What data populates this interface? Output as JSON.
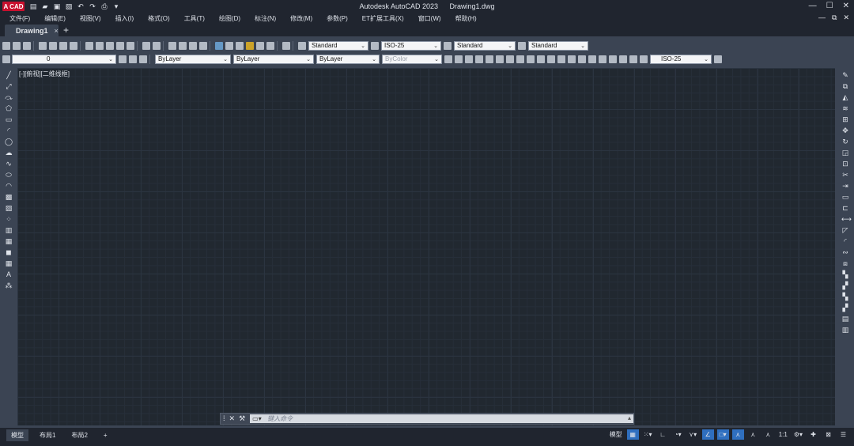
{
  "app": {
    "logo": "A CAD",
    "title": "Autodesk AutoCAD 2023",
    "file": "Drawing1.dwg"
  },
  "window_controls": [
    "—",
    "☐",
    "✕"
  ],
  "doc_controls": [
    "—",
    "⧉",
    "✕"
  ],
  "menu": [
    "文件(F)",
    "编辑(E)",
    "视图(V)",
    "插入(I)",
    "格式(O)",
    "工具(T)",
    "绘图(D)",
    "标注(N)",
    "修改(M)",
    "参数(P)",
    "ET扩展工具(X)",
    "窗口(W)",
    "帮助(H)"
  ],
  "tabs": {
    "active": "Drawing1",
    "close": "×",
    "add": "+"
  },
  "toolbar1": {
    "text_style": "Standard",
    "dim_style": "ISO-25",
    "table_style": "Standard",
    "mleader_style": "Standard"
  },
  "toolbar2": {
    "layer": "0",
    "color": "ByLayer",
    "linetype": "ByLayer",
    "lineweight": "ByLayer",
    "plotstyle": "ByColor",
    "dim_style2": "ISO-25"
  },
  "viewport_label": "[-][俯视][二维线框]",
  "command_line": {
    "placeholder": "键入命令",
    "close": "✕",
    "tools": "⚙"
  },
  "layout_tabs": [
    "模型",
    "布局1",
    "布局2"
  ],
  "layout_add": "+",
  "status": {
    "model": "模型",
    "scale": "1:1"
  }
}
